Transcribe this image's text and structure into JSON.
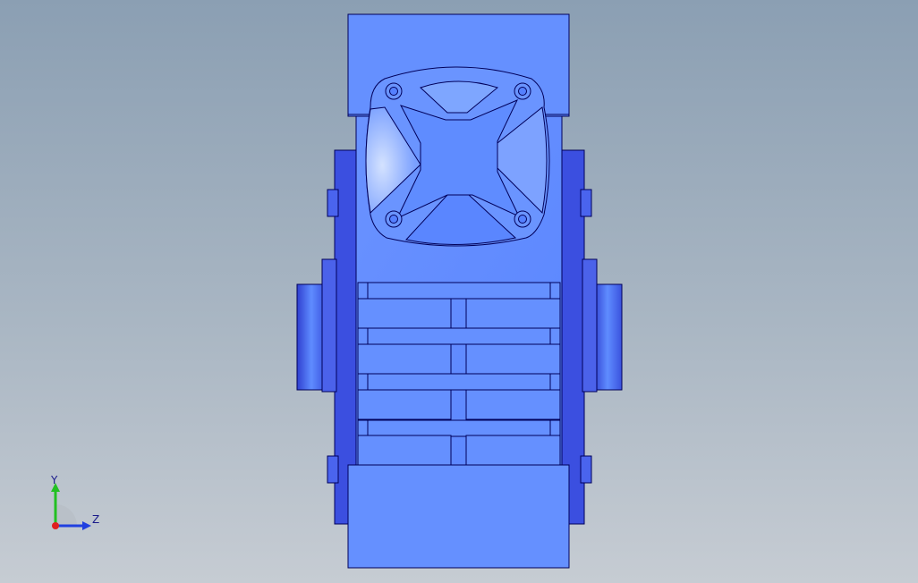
{
  "viewport": {
    "background_top": "#8b9fb3",
    "background_bottom": "#c6ccd3"
  },
  "model": {
    "name": "worm-gearbox",
    "body_color": "#5f8cff",
    "edge_color": "#00005a",
    "shade_color": "#4a63e0"
  },
  "triad": {
    "y_label": "Y",
    "z_label": "Z",
    "y_color": "#22c022",
    "z_color": "#2040e0",
    "origin_color": "#e02020"
  }
}
